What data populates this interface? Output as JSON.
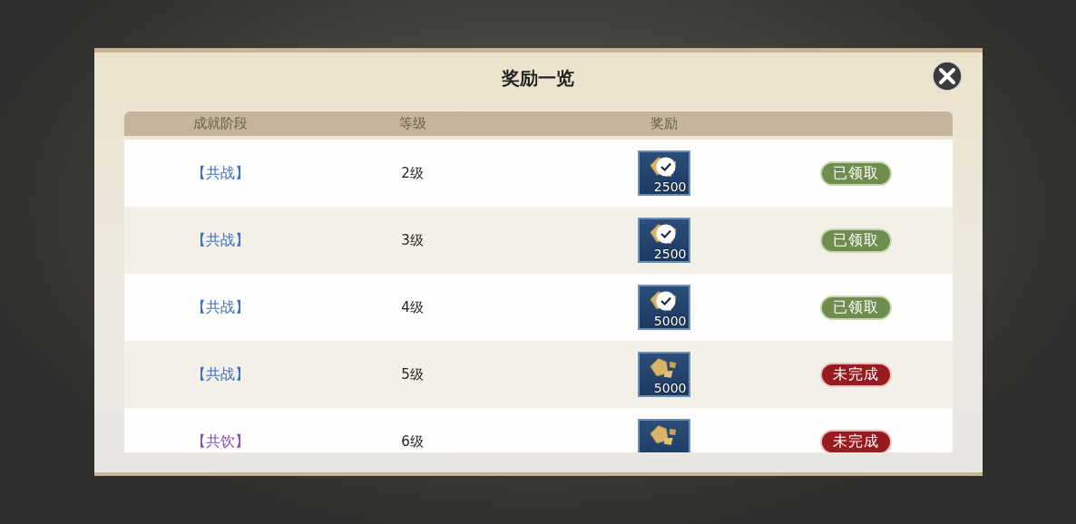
{
  "dialog": {
    "title": "奖励一览"
  },
  "table": {
    "columns": [
      "成就阶段",
      "等级",
      "奖励"
    ],
    "rows": [
      {
        "stage": "【共战】",
        "color": "#3f6fc0",
        "level": "2级",
        "reward": {
          "claimed": true,
          "amount": "2500"
        },
        "status": {
          "kind": "claimed",
          "label": "已领取"
        }
      },
      {
        "stage": "【共战】",
        "color": "#3f6fc0",
        "level": "3级",
        "reward": {
          "claimed": true,
          "amount": "2500"
        },
        "status": {
          "kind": "claimed",
          "label": "已领取"
        }
      },
      {
        "stage": "【共战】",
        "color": "#3f6fc0",
        "level": "4级",
        "reward": {
          "claimed": true,
          "amount": "5000"
        },
        "status": {
          "kind": "claimed",
          "label": "已领取"
        }
      },
      {
        "stage": "【共战】",
        "color": "#3f6fc0",
        "level": "5级",
        "reward": {
          "claimed": false,
          "amount": "5000"
        },
        "status": {
          "kind": "incomplete",
          "label": "未完成"
        }
      },
      {
        "stage": "【共饮】",
        "color": "#8a4fb5",
        "level": "6级",
        "reward": {
          "claimed": false
        },
        "status": {
          "kind": "incomplete",
          "label": "未完成"
        }
      }
    ]
  }
}
